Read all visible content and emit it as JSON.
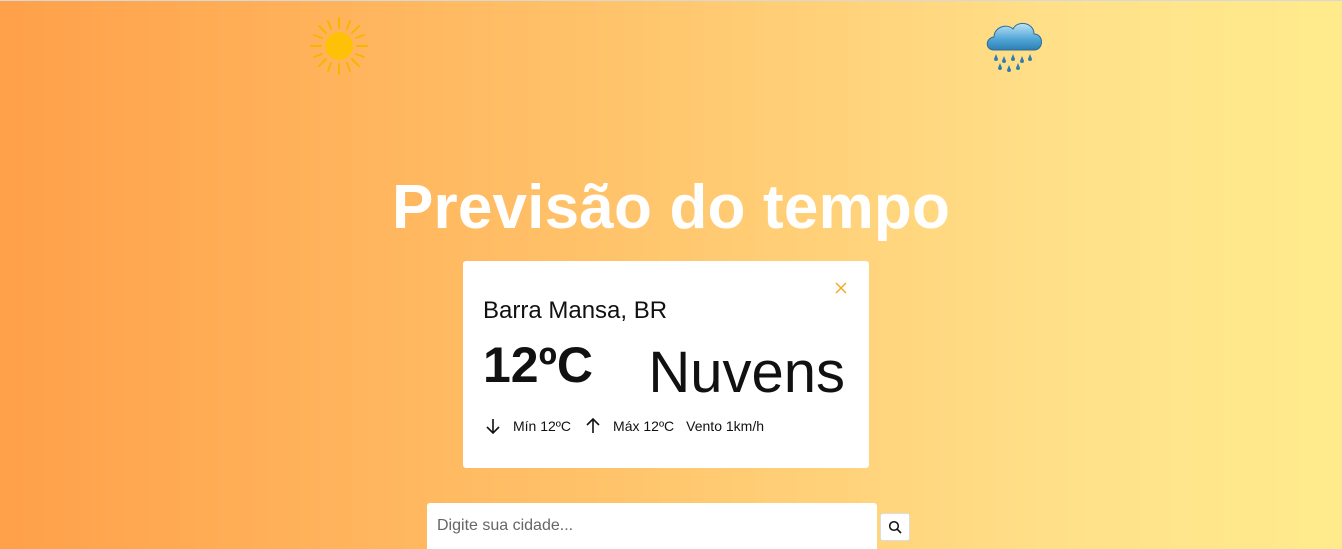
{
  "header": {
    "title": "Previsão do tempo"
  },
  "decor": {
    "left_icon": "sun-icon",
    "right_icon": "rain-cloud-icon"
  },
  "weather_card": {
    "city": "Barra Mansa, BR",
    "temperature": "12ºC",
    "condition": "Nuvens",
    "min_label": "Mín 12ºC",
    "max_label": "Máx 12ºC",
    "wind_label": "Vento 1km/h",
    "close_icon": "close-icon"
  },
  "search": {
    "placeholder": "Digite sua cidade...",
    "value": "",
    "button_icon": "search-icon"
  },
  "colors": {
    "gradient_start": "#ffa04a",
    "gradient_end": "#ffeb8c",
    "accent": "#f5a623",
    "card_bg": "#ffffff"
  }
}
